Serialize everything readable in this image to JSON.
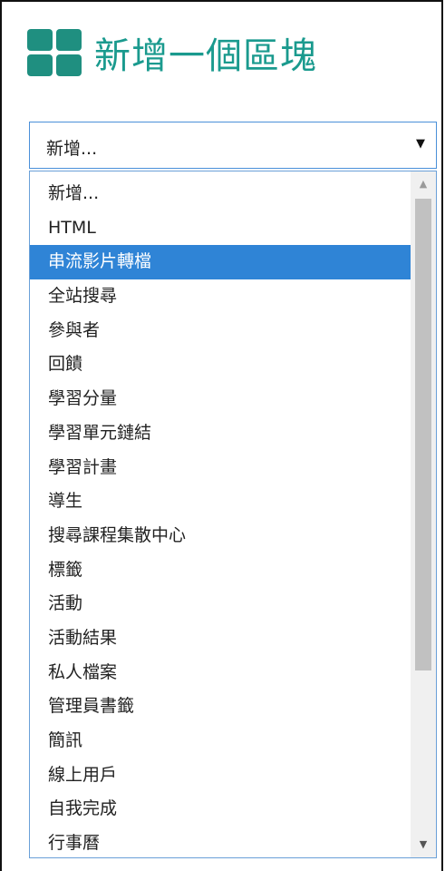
{
  "header": {
    "title": "新增一個區塊",
    "icon": "grid-icon",
    "accent_color": "#1a9a8e"
  },
  "select": {
    "value": "新增...",
    "caret": "▼"
  },
  "dropdown": {
    "options": [
      "新增...",
      "HTML",
      "串流影片轉檔",
      "全站搜尋",
      "參與者",
      "回饋",
      "學習分量",
      "學習單元鏈結",
      "學習計畫",
      "導生",
      "搜尋課程集散中心",
      "標籤",
      "活動",
      "活動結果",
      "私人檔案",
      "管理員書籤",
      "簡訊",
      "線上用戶",
      "自我完成",
      "行事曆"
    ],
    "selected_index": 2,
    "highlight_color": "#2f84d6",
    "scroll_up": "▲",
    "scroll_down": "▼"
  }
}
